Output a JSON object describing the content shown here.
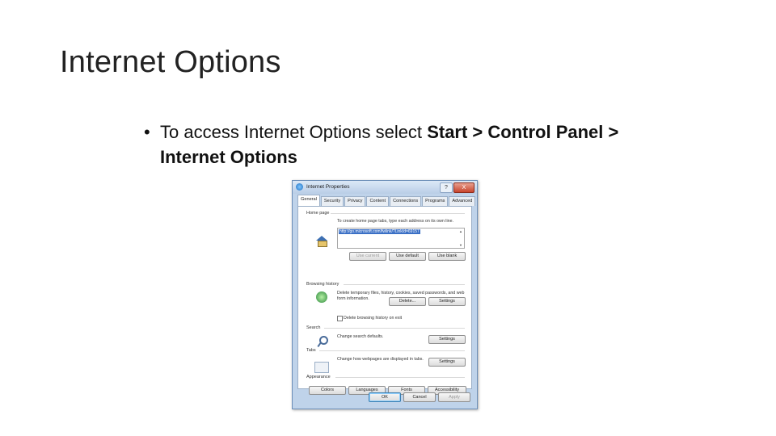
{
  "slide": {
    "title": "Internet Options",
    "bullet_prefix": "To access Internet Options select",
    "bullet_bold": "Start > Control Panel > Internet Options"
  },
  "dialog": {
    "title": "Internet Properties",
    "help_label": "?",
    "close_label": "X",
    "tabs": [
      "General",
      "Security",
      "Privacy",
      "Content",
      "Connections",
      "Programs",
      "Advanced"
    ],
    "home_page": {
      "label": "Home page",
      "instruction": "To create home page tabs, type each address on its own line.",
      "url": "http://go.microsoft.com/fwlink/?LinkId=69157",
      "buttons": [
        "Use current",
        "Use default",
        "Use blank"
      ]
    },
    "browsing_history": {
      "label": "Browsing history",
      "description": "Delete temporary files, history, cookies, saved passwords, and web form information.",
      "checkbox_label": "Delete browsing history on exit",
      "buttons": [
        "Delete...",
        "Settings"
      ]
    },
    "search": {
      "label": "Search",
      "description": "Change search defaults.",
      "button": "Settings"
    },
    "tabs_section": {
      "label": "Tabs",
      "description": "Change how webpages are displayed in tabs.",
      "button": "Settings"
    },
    "appearance": {
      "label": "Appearance",
      "buttons": [
        "Colors",
        "Languages",
        "Fonts",
        "Accessibility"
      ]
    },
    "footer": {
      "buttons": [
        "OK",
        "Cancel",
        "Apply"
      ]
    }
  }
}
